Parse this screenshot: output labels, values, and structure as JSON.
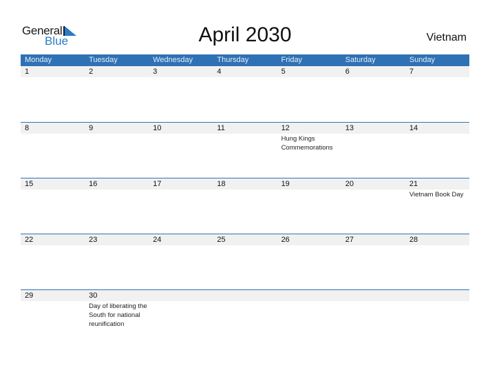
{
  "logo": {
    "general": "General",
    "blue": "Blue"
  },
  "title": "April 2030",
  "country": "Vietnam",
  "colors": {
    "header_bg": "#2e71b5",
    "logo_blue": "#2a7bc4",
    "day_band": "#f1f1f1"
  },
  "weekdays": [
    "Monday",
    "Tuesday",
    "Wednesday",
    "Thursday",
    "Friday",
    "Saturday",
    "Sunday"
  ],
  "weeks": [
    [
      {
        "day": "1",
        "event": ""
      },
      {
        "day": "2",
        "event": ""
      },
      {
        "day": "3",
        "event": ""
      },
      {
        "day": "4",
        "event": ""
      },
      {
        "day": "5",
        "event": ""
      },
      {
        "day": "6",
        "event": ""
      },
      {
        "day": "7",
        "event": ""
      }
    ],
    [
      {
        "day": "8",
        "event": ""
      },
      {
        "day": "9",
        "event": ""
      },
      {
        "day": "10",
        "event": ""
      },
      {
        "day": "11",
        "event": ""
      },
      {
        "day": "12",
        "event": "Hung Kings Commemorations"
      },
      {
        "day": "13",
        "event": ""
      },
      {
        "day": "14",
        "event": ""
      }
    ],
    [
      {
        "day": "15",
        "event": ""
      },
      {
        "day": "16",
        "event": ""
      },
      {
        "day": "17",
        "event": ""
      },
      {
        "day": "18",
        "event": ""
      },
      {
        "day": "19",
        "event": ""
      },
      {
        "day": "20",
        "event": ""
      },
      {
        "day": "21",
        "event": "Vietnam Book Day"
      }
    ],
    [
      {
        "day": "22",
        "event": ""
      },
      {
        "day": "23",
        "event": ""
      },
      {
        "day": "24",
        "event": ""
      },
      {
        "day": "25",
        "event": ""
      },
      {
        "day": "26",
        "event": ""
      },
      {
        "day": "27",
        "event": ""
      },
      {
        "day": "28",
        "event": ""
      }
    ],
    [
      {
        "day": "29",
        "event": ""
      },
      {
        "day": "30",
        "event": "Day of liberating the South for national reunification"
      },
      {
        "day": "",
        "event": ""
      },
      {
        "day": "",
        "event": ""
      },
      {
        "day": "",
        "event": ""
      },
      {
        "day": "",
        "event": ""
      },
      {
        "day": "",
        "event": ""
      }
    ]
  ]
}
